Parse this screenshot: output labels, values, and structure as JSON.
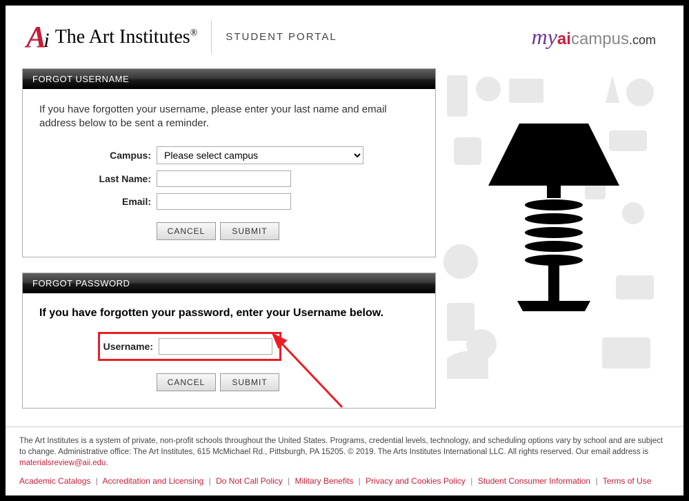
{
  "header": {
    "logo_text": "The Art Institutes",
    "portal_title": "STUDENT PORTAL",
    "right_logo": {
      "my": "my",
      "ai": "ai",
      "campus": "campus",
      "com": ".com"
    }
  },
  "panels": {
    "forgot_username": {
      "title": "FORGOT USERNAME",
      "instruction": "If you have forgotten your username, please enter your last name and email address below to be sent a reminder.",
      "fields": {
        "campus_label": "Campus:",
        "campus_placeholder": "Please select campus",
        "lastname_label": "Last Name:",
        "email_label": "Email:"
      },
      "buttons": {
        "cancel": "CANCEL",
        "submit": "SUBMIT"
      }
    },
    "forgot_password": {
      "title": "FORGOT PASSWORD",
      "instruction": "If you have forgotten your password, enter your Username below.",
      "fields": {
        "username_label": "Username:"
      },
      "buttons": {
        "cancel": "CANCEL",
        "submit": "SUBMIT"
      }
    }
  },
  "footer": {
    "text_1": "The Art Institutes is a system of private, non-profit schools throughout the United States. Programs, credential levels, technology, and scheduling options vary by school and are subject to change. Administrative office: The Art Institutes, 615 McMichael Rd., Pittsburgh, PA 15205. © 2019. The Arts Institutes International LLC. All rights reserved. Our email address is ",
    "email": "materialsreview@aii.edu",
    "links": [
      "Academic Catalogs",
      "Accreditation and Licensing",
      "Do Not Call Policy",
      "Military Benefits",
      "Privacy and Cookies Policy",
      "Student Consumer Information",
      "Terms of Use"
    ]
  }
}
